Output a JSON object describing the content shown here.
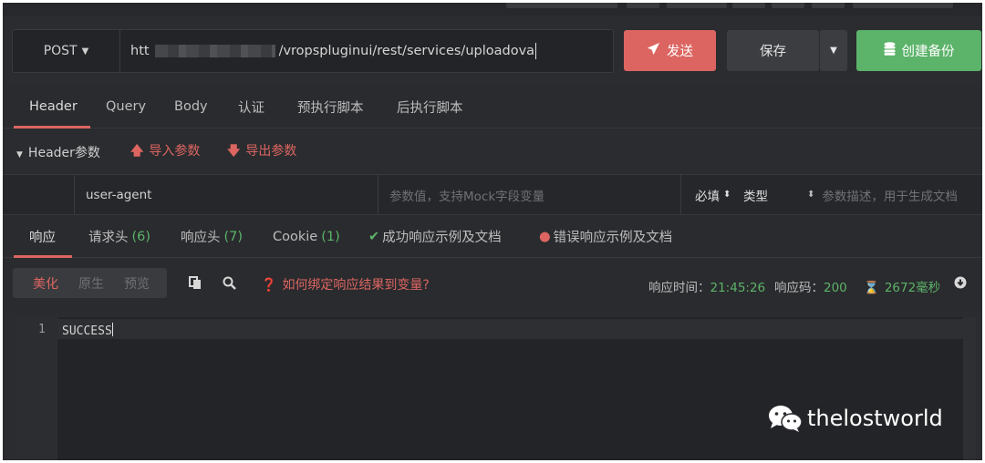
{
  "request": {
    "method": "POST",
    "url_prefix": "htt",
    "url_visible": "/vropspluginui/rest/services/uploadova"
  },
  "buttons": {
    "send": "发送",
    "save": "保存",
    "backup": "创建备份"
  },
  "request_tabs": [
    "Header",
    "Query",
    "Body",
    "认证",
    "预执行脚本",
    "后执行脚本"
  ],
  "header_section": {
    "toggle": "Header参数",
    "import": "导入参数",
    "export": "导出参数"
  },
  "param_row": {
    "key": "user-agent",
    "value_placeholder": "参数值，支持Mock字段变量",
    "required": "必填",
    "type": "类型",
    "desc_placeholder": "参数描述，用于生成文档"
  },
  "response_tabs": [
    {
      "label": "响应",
      "count": ""
    },
    {
      "label": "请求头",
      "count": "(6)"
    },
    {
      "label": "响应头",
      "count": "(7)"
    },
    {
      "label": "Cookie",
      "count": "(1)"
    },
    {
      "label": "成功响应示例及文档",
      "count": ""
    },
    {
      "label": "错误响应示例及文档",
      "count": ""
    }
  ],
  "toolbar": {
    "modes": [
      "美化",
      "原生",
      "预览"
    ],
    "howto": "如何绑定响应结果到变量?",
    "time_label": "响应时间：",
    "time_value": "21:45:26",
    "code_label": "响应码：",
    "code_value": "200",
    "duration": "2672毫秒"
  },
  "editor": {
    "line_number": "1",
    "content": "SUCCESS"
  },
  "watermark": "thelostworld",
  "colors": {
    "accent_red": "#dc6561",
    "accent_green": "#5cb36a",
    "background": "#2b2c2f"
  }
}
